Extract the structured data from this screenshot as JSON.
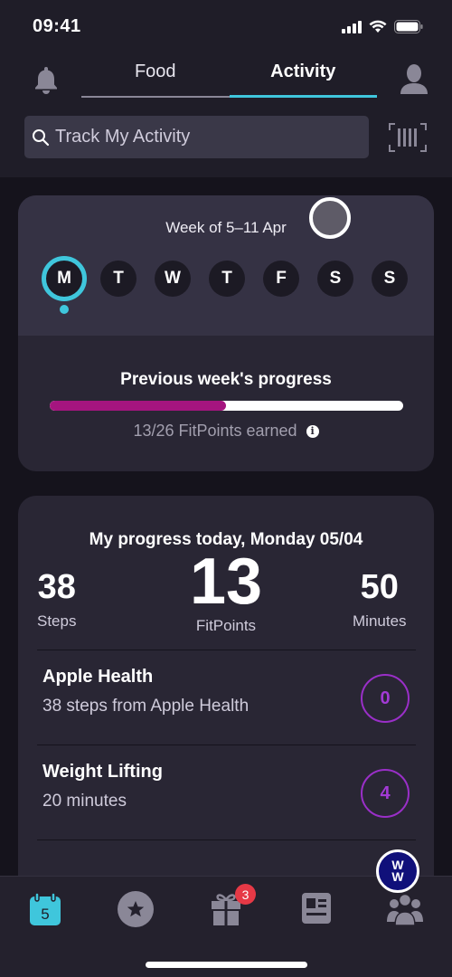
{
  "status_bar": {
    "time": "09:41"
  },
  "header": {
    "tabs": [
      {
        "label": "Food",
        "active": false
      },
      {
        "label": "Activity",
        "active": true
      }
    ],
    "search": {
      "placeholder": "Track My Activity",
      "value": ""
    }
  },
  "week": {
    "title": "Week of 5–11 Apr",
    "days": [
      "M",
      "T",
      "W",
      "T",
      "F",
      "S",
      "S"
    ],
    "selected_index": 0,
    "previous": {
      "title": "Previous week's progress",
      "earned": 13,
      "goal": 26,
      "progress_fraction": 0.5,
      "summary": "13/26 FitPoints earned"
    }
  },
  "today": {
    "title": "My progress today, Monday 05/04",
    "stats": {
      "steps": {
        "value": "38",
        "label": "Steps"
      },
      "fitpoints": {
        "value": "13",
        "label": "FitPoints"
      },
      "minutes": {
        "value": "50",
        "label": "Minutes"
      }
    },
    "activities": [
      {
        "title": "Apple Health",
        "subtitle": "38 steps from Apple Health",
        "points": "0"
      },
      {
        "title": "Weight Lifting",
        "subtitle": "20 minutes",
        "points": "4"
      }
    ]
  },
  "ww_badge": {
    "line1": "W",
    "line2": "W"
  },
  "bottom_nav": {
    "items": [
      {
        "name": "my-day",
        "icon": "calendar-icon",
        "text": "5",
        "active": true
      },
      {
        "name": "wellness",
        "icon": "star-icon",
        "active": false
      },
      {
        "name": "rewards",
        "icon": "gift-icon",
        "badge": "3",
        "active": false
      },
      {
        "name": "discover",
        "icon": "news-icon",
        "active": false
      },
      {
        "name": "connect",
        "icon": "people-icon",
        "active": false
      }
    ]
  },
  "colors": {
    "accent": "#3fc6dc",
    "progress": "#a5157f",
    "points": "#a33ad6",
    "badge": "#e63946",
    "ww_blue": "#10107a"
  }
}
